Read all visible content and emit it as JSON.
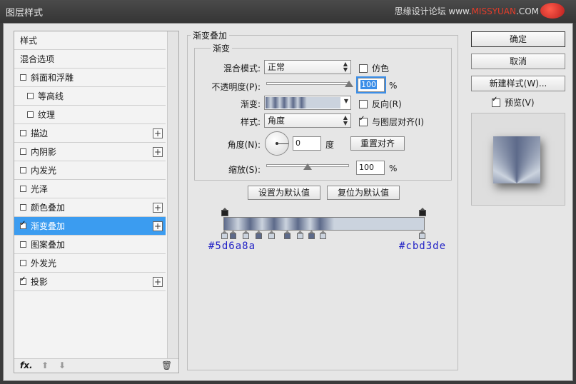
{
  "window": {
    "title": "图层样式",
    "watermark_text": "思缘设计论坛",
    "watermark_domain_prefix": "www.",
    "watermark_domain_red": "MISSYUAN",
    "watermark_domain_suffix": ".COM"
  },
  "sidebar": {
    "header": "样式",
    "blend_options": "混合选项",
    "items": [
      {
        "label": "斜面和浮雕",
        "checked": false,
        "indent": false,
        "plus": false
      },
      {
        "label": "等高线",
        "checked": false,
        "indent": true,
        "plus": false
      },
      {
        "label": "纹理",
        "checked": false,
        "indent": true,
        "plus": false
      },
      {
        "label": "描边",
        "checked": false,
        "indent": false,
        "plus": true
      },
      {
        "label": "内阴影",
        "checked": false,
        "indent": false,
        "plus": true
      },
      {
        "label": "内发光",
        "checked": false,
        "indent": false,
        "plus": false
      },
      {
        "label": "光泽",
        "checked": false,
        "indent": false,
        "plus": false
      },
      {
        "label": "颜色叠加",
        "checked": false,
        "indent": false,
        "plus": true
      },
      {
        "label": "渐变叠加",
        "checked": true,
        "indent": false,
        "plus": true,
        "selected": true
      },
      {
        "label": "图案叠加",
        "checked": false,
        "indent": false,
        "plus": false
      },
      {
        "label": "外发光",
        "checked": false,
        "indent": false,
        "plus": false
      },
      {
        "label": "投影",
        "checked": true,
        "indent": false,
        "plus": true
      }
    ],
    "footer": {
      "fx_label": "fx",
      "fx_suffix": "."
    }
  },
  "panel": {
    "group_title": "渐变叠加",
    "section_title": "渐变",
    "blend_mode": {
      "label": "混合模式:",
      "value": "正常"
    },
    "dither": {
      "label": "仿色",
      "checked": false
    },
    "opacity": {
      "label": "不透明度(P):",
      "value": "100",
      "unit": "%",
      "level": 1.0
    },
    "gradient": {
      "label": "渐变:"
    },
    "reverse": {
      "label": "反向(R)",
      "checked": false
    },
    "style": {
      "label": "样式:",
      "value": "角度"
    },
    "align": {
      "label": "与图层对齐(I)",
      "checked": true
    },
    "angle": {
      "label": "角度(N):",
      "value": "0",
      "unit": "度"
    },
    "reset_align": "重置对齐",
    "scale": {
      "label": "缩放(S):",
      "value": "100",
      "unit": "%",
      "level": 0.5
    },
    "set_default": "设置为默认值",
    "reset_default": "复位为默认值"
  },
  "gradient_editor": {
    "left_color": "#5d6a8a",
    "right_color": "#cbd3de"
  },
  "actions": {
    "ok": "确定",
    "cancel": "取消",
    "new_style": "新建样式(W)...",
    "preview": {
      "label": "预览(V)",
      "checked": true
    }
  }
}
